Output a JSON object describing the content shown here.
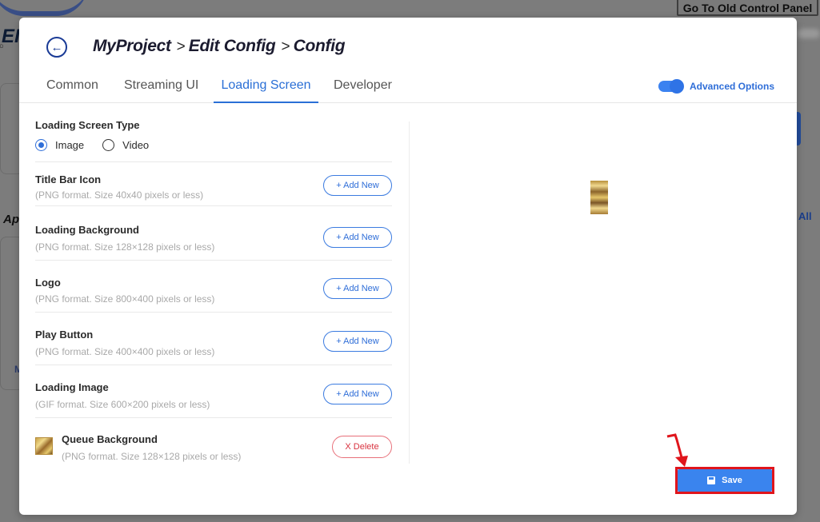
{
  "background": {
    "old_panel_label": "Go To Old Control Panel",
    "logo_letters": "EI",
    "logo_sub": "D",
    "partial_heading": "Ap",
    "all_label": "All",
    "partial_letter": "M"
  },
  "header": {
    "breadcrumb": [
      "MyProject",
      "Edit Config",
      "Config"
    ],
    "separator": ">"
  },
  "tabs": [
    {
      "label": "Common",
      "active": false
    },
    {
      "label": "Streaming UI",
      "active": false
    },
    {
      "label": "Loading Screen",
      "active": true
    },
    {
      "label": "Developer",
      "active": false
    }
  ],
  "advanced_options": {
    "label": "Advanced Options",
    "enabled": true
  },
  "loading_screen": {
    "type_title": "Loading Screen Type",
    "options": [
      {
        "label": "Image",
        "checked": true
      },
      {
        "label": "Video",
        "checked": false
      }
    ],
    "items": [
      {
        "title": "Title Bar Icon",
        "hint": "(PNG format. Size 40x40 pixels or less)",
        "action": "+ Add New",
        "has_image": false
      },
      {
        "title": "Loading Background",
        "hint": "(PNG format. Size 128×128 pixels or less)",
        "action": "+ Add New",
        "has_image": false
      },
      {
        "title": "Logo",
        "hint": "(PNG format. Size 800×400 pixels or less)",
        "action": "+ Add New",
        "has_image": false
      },
      {
        "title": "Play Button",
        "hint": "(PNG format. Size 400×400 pixels or less)",
        "action": "+ Add New",
        "has_image": false
      },
      {
        "title": "Loading Image",
        "hint": "(GIF format. Size 600×200 pixels or less)",
        "action": "+ Add New",
        "has_image": false
      },
      {
        "title": "Queue Background",
        "hint": "(PNG format. Size 128×128 pixels or less)",
        "action": "X Delete",
        "has_image": true
      }
    ]
  },
  "footer": {
    "save_label": "Save"
  },
  "colors": {
    "accent": "#2f6ed8",
    "save": "#3a84ee",
    "delete": "#d8323f",
    "highlight": "#e0151c"
  }
}
